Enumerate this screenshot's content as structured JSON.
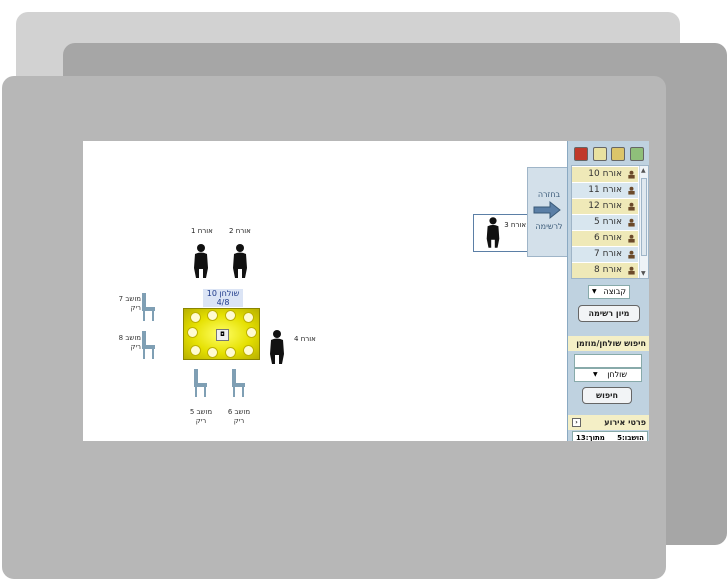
{
  "canvas": {
    "table": {
      "name": "שולחן 10",
      "capacity": "4/8"
    },
    "guests": [
      {
        "label": "אורח 1"
      },
      {
        "label": "אורח 2"
      },
      {
        "label": "אורח 4"
      }
    ],
    "seats": [
      {
        "label": "מושב 7",
        "status": "ריק"
      },
      {
        "label": "מושב 8",
        "status": "ריק"
      },
      {
        "label": "מושב 5",
        "status": "ריק"
      },
      {
        "label": "מושב 6",
        "status": "ריק"
      }
    ],
    "dragged_guest": {
      "label": "אורח 3"
    },
    "back_panel": {
      "line1": "בחזרה",
      "line2": "לרשימה"
    }
  },
  "sidebar": {
    "toolbar_icons": [
      "guest-red-icon",
      "guest-add-icon",
      "guest-edit-icon",
      "table-icon"
    ],
    "guest_list": [
      {
        "label": "אורח 10",
        "highlight": true
      },
      {
        "label": "אורח 11",
        "highlight": false
      },
      {
        "label": "אורח 12",
        "highlight": true
      },
      {
        "label": "אורח 5",
        "highlight": false
      },
      {
        "label": "אורח 6",
        "highlight": true
      },
      {
        "label": "אורח 7",
        "highlight": false
      },
      {
        "label": "אורח 8",
        "highlight": true
      }
    ],
    "group_select": "קבוצה",
    "sort_button": "מיון רשימה",
    "search_section": {
      "title": "חיפוש שולחן/מוזמן",
      "type_select": "שולחן",
      "search_button": "חיפוש"
    },
    "event_details": {
      "title": "פרטי אירוע",
      "seated": "הושבו:5",
      "total": "מתוך:13"
    }
  },
  "colors": {
    "sidebar_bg": "#bfd2e0",
    "list_highlight": "#efe9b8",
    "table_yellow": "#e5e000",
    "chair_blue": "#7f9fb4"
  }
}
